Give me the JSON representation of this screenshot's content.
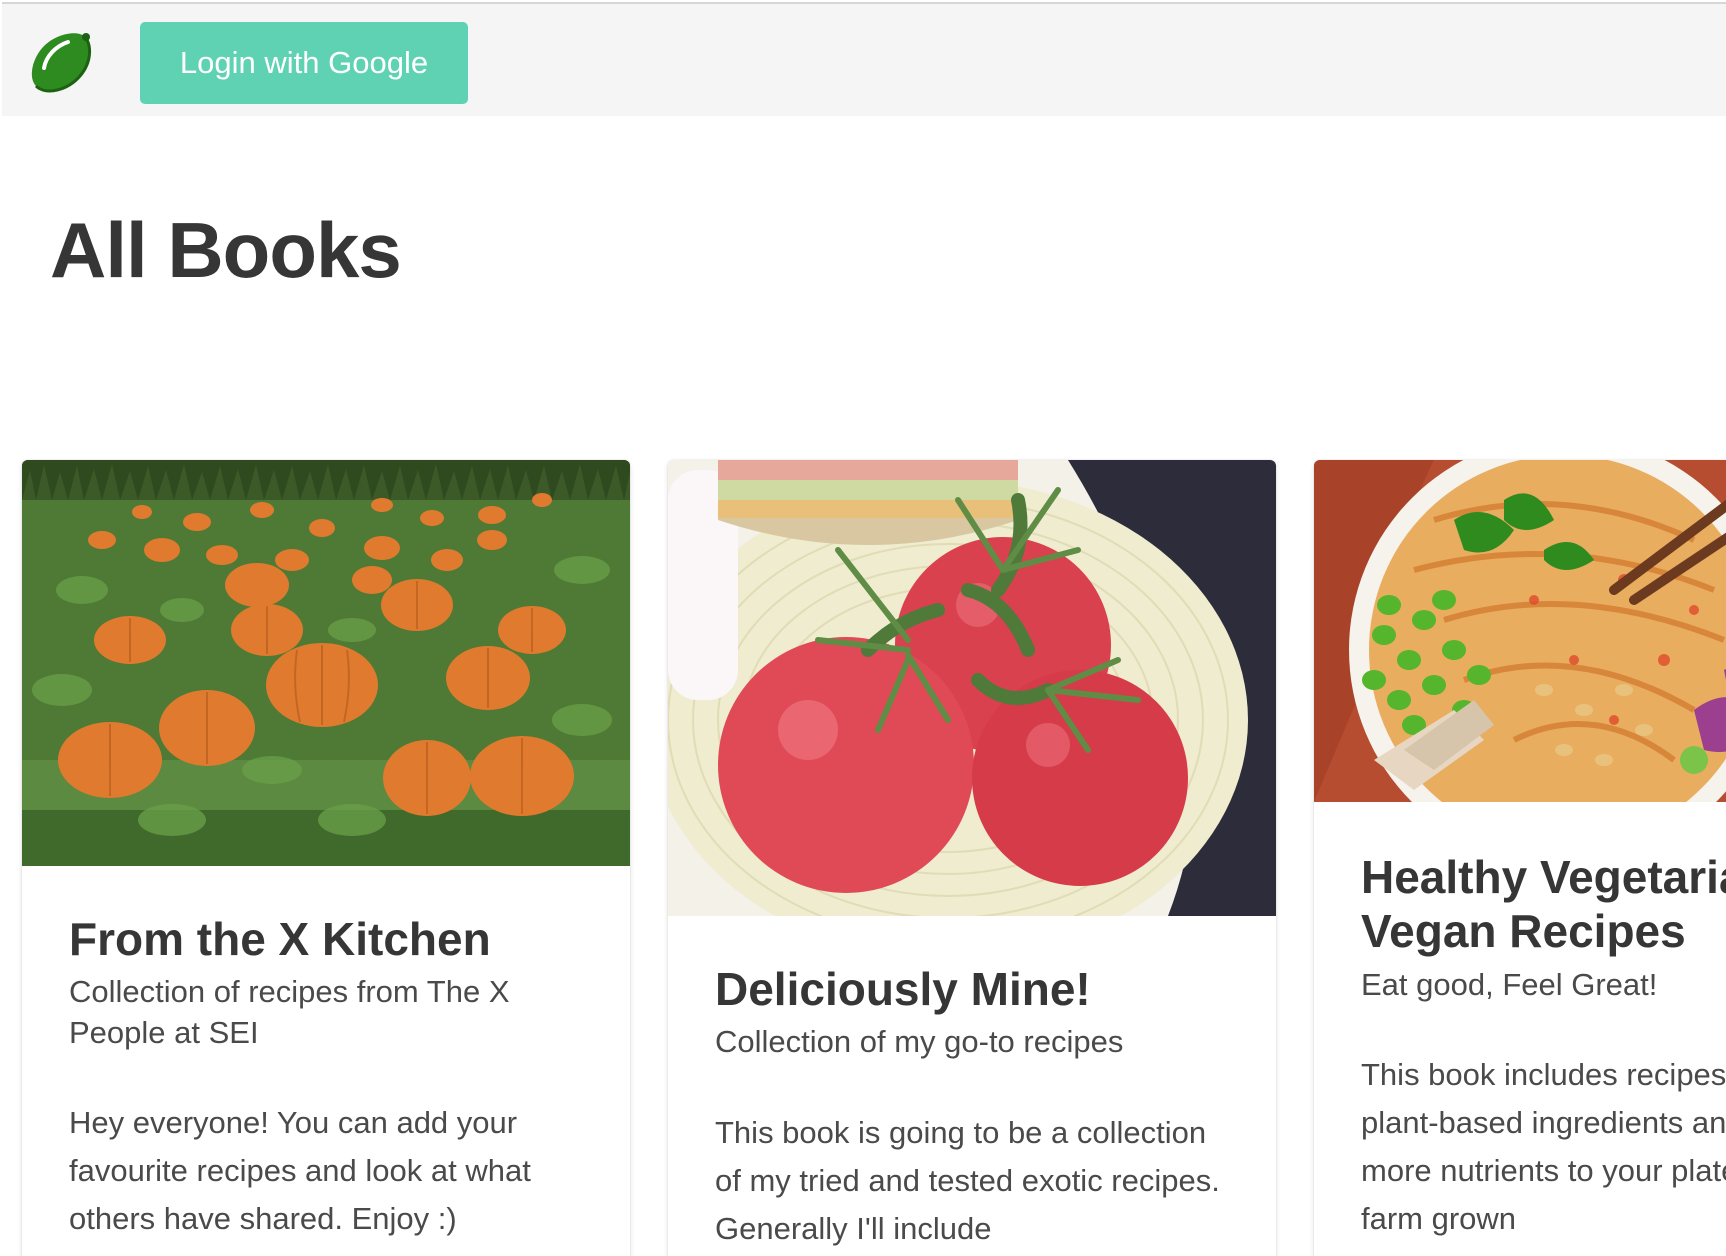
{
  "navbar": {
    "logo_icon": "lime-icon",
    "login_label": "Login with Google",
    "login_color": "#5fd2b4"
  },
  "main": {
    "title": "All Books"
  },
  "books": [
    {
      "image_icon": "pumpkin-field-image",
      "title": "From the X Kitchen",
      "subtitle": "Collection of recipes from The X People at SEI",
      "description": "Hey everyone! You can add your favourite recipes and look at what others have shared. Enjoy :)"
    },
    {
      "image_icon": "tomatoes-image",
      "title": "Deliciously Mine!",
      "subtitle": "Collection of my go-to recipes",
      "description": "This book is going to be a collection of my tried and tested exotic recipes. Generally I'll include"
    },
    {
      "image_icon": "noodle-bowl-image",
      "title": "Healthy Vegetarian Vegan Recipes",
      "subtitle": "Eat good, Feel Great!",
      "description": "This book includes recipes mostly plant-based ingredients and will add more nutrients to your plate. Use local, farm grown"
    }
  ]
}
